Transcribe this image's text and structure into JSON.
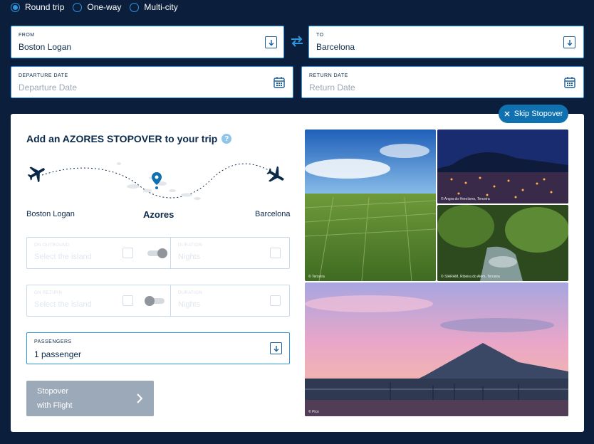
{
  "trip_types": [
    {
      "label": "Round trip",
      "selected": true
    },
    {
      "label": "One-way",
      "selected": false
    },
    {
      "label": "Multi-city",
      "selected": false
    }
  ],
  "from": {
    "label": "FROM",
    "value": "Boston Logan"
  },
  "to": {
    "label": "TO",
    "value": "Barcelona"
  },
  "departure": {
    "label": "DEPARTURE DATE",
    "placeholder": "Departure Date"
  },
  "return": {
    "label": "RETURN DATE",
    "placeholder": "Return Date"
  },
  "stopover": {
    "skip_label": "Skip Stopover",
    "title": "Add an AZORES STOPOVER to your trip",
    "help": "?",
    "origin": "Boston Logan",
    "hub": "Azores",
    "destination": "Barcelona",
    "outbound": {
      "island_label": "ON OUTBOUND",
      "island_placeholder": "Select the island",
      "duration_label": "DURATION",
      "duration_placeholder": "Nights"
    },
    "return": {
      "island_label": "ON RETURN",
      "island_placeholder": "Select the island",
      "duration_label": "DURATION",
      "duration_placeholder": "Nights"
    },
    "passengers": {
      "label": "PASSENGERS",
      "value": "1 passenger"
    },
    "cta": {
      "line1": "Stopover",
      "line2": "with Flight"
    },
    "photo_credits": {
      "terceira": "© Terceira",
      "angra": "© Angra do Heroísmo, Terceira",
      "ribeira": "© SIARAM, Ribeira do Além, Terceira",
      "pico": "© Pico"
    }
  },
  "colors": {
    "background": "#0b1f3d",
    "accent": "#2f95dc",
    "skip_button": "#0f71b0"
  }
}
